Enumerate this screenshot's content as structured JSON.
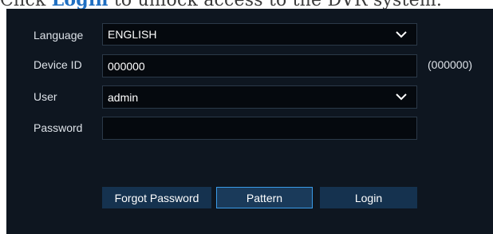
{
  "caption": {
    "pre": "Click ",
    "link": "Login",
    "post": " to unlock access to the DVR system."
  },
  "form": {
    "language_label": "Language",
    "language_value": "ENGLISH",
    "device_label": "Device ID",
    "device_value": "000000",
    "device_hint": "(000000)",
    "user_label": "User",
    "user_value": "admin",
    "password_label": "Password",
    "password_value": ""
  },
  "buttons": {
    "forgot": "Forgot Password",
    "pattern": "Pattern",
    "login": "Login"
  },
  "icons": {
    "dropdown": "chevron-down-icon"
  },
  "colors": {
    "panel": "#0e1620",
    "button": "#15324f",
    "focus_border": "#3a9be8",
    "link": "#1f6fc2"
  }
}
